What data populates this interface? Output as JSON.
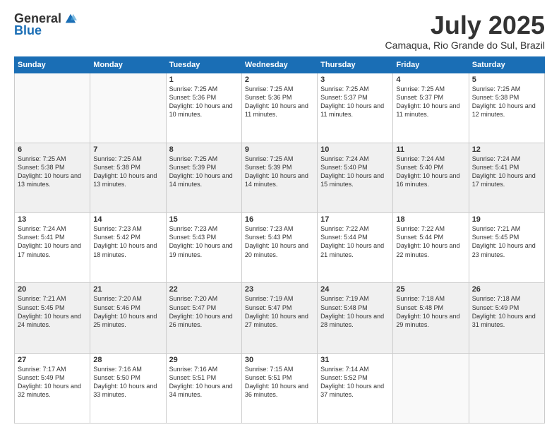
{
  "header": {
    "logo_general": "General",
    "logo_blue": "Blue",
    "month_title": "July 2025",
    "subtitle": "Camaqua, Rio Grande do Sul, Brazil"
  },
  "days_of_week": [
    "Sunday",
    "Monday",
    "Tuesday",
    "Wednesday",
    "Thursday",
    "Friday",
    "Saturday"
  ],
  "weeks": [
    [
      {
        "day": "",
        "info": ""
      },
      {
        "day": "",
        "info": ""
      },
      {
        "day": "1",
        "info": "Sunrise: 7:25 AM\nSunset: 5:36 PM\nDaylight: 10 hours and 10 minutes."
      },
      {
        "day": "2",
        "info": "Sunrise: 7:25 AM\nSunset: 5:36 PM\nDaylight: 10 hours and 11 minutes."
      },
      {
        "day": "3",
        "info": "Sunrise: 7:25 AM\nSunset: 5:37 PM\nDaylight: 10 hours and 11 minutes."
      },
      {
        "day": "4",
        "info": "Sunrise: 7:25 AM\nSunset: 5:37 PM\nDaylight: 10 hours and 11 minutes."
      },
      {
        "day": "5",
        "info": "Sunrise: 7:25 AM\nSunset: 5:38 PM\nDaylight: 10 hours and 12 minutes."
      }
    ],
    [
      {
        "day": "6",
        "info": "Sunrise: 7:25 AM\nSunset: 5:38 PM\nDaylight: 10 hours and 13 minutes."
      },
      {
        "day": "7",
        "info": "Sunrise: 7:25 AM\nSunset: 5:38 PM\nDaylight: 10 hours and 13 minutes."
      },
      {
        "day": "8",
        "info": "Sunrise: 7:25 AM\nSunset: 5:39 PM\nDaylight: 10 hours and 14 minutes."
      },
      {
        "day": "9",
        "info": "Sunrise: 7:25 AM\nSunset: 5:39 PM\nDaylight: 10 hours and 14 minutes."
      },
      {
        "day": "10",
        "info": "Sunrise: 7:24 AM\nSunset: 5:40 PM\nDaylight: 10 hours and 15 minutes."
      },
      {
        "day": "11",
        "info": "Sunrise: 7:24 AM\nSunset: 5:40 PM\nDaylight: 10 hours and 16 minutes."
      },
      {
        "day": "12",
        "info": "Sunrise: 7:24 AM\nSunset: 5:41 PM\nDaylight: 10 hours and 17 minutes."
      }
    ],
    [
      {
        "day": "13",
        "info": "Sunrise: 7:24 AM\nSunset: 5:41 PM\nDaylight: 10 hours and 17 minutes."
      },
      {
        "day": "14",
        "info": "Sunrise: 7:23 AM\nSunset: 5:42 PM\nDaylight: 10 hours and 18 minutes."
      },
      {
        "day": "15",
        "info": "Sunrise: 7:23 AM\nSunset: 5:43 PM\nDaylight: 10 hours and 19 minutes."
      },
      {
        "day": "16",
        "info": "Sunrise: 7:23 AM\nSunset: 5:43 PM\nDaylight: 10 hours and 20 minutes."
      },
      {
        "day": "17",
        "info": "Sunrise: 7:22 AM\nSunset: 5:44 PM\nDaylight: 10 hours and 21 minutes."
      },
      {
        "day": "18",
        "info": "Sunrise: 7:22 AM\nSunset: 5:44 PM\nDaylight: 10 hours and 22 minutes."
      },
      {
        "day": "19",
        "info": "Sunrise: 7:21 AM\nSunset: 5:45 PM\nDaylight: 10 hours and 23 minutes."
      }
    ],
    [
      {
        "day": "20",
        "info": "Sunrise: 7:21 AM\nSunset: 5:45 PM\nDaylight: 10 hours and 24 minutes."
      },
      {
        "day": "21",
        "info": "Sunrise: 7:20 AM\nSunset: 5:46 PM\nDaylight: 10 hours and 25 minutes."
      },
      {
        "day": "22",
        "info": "Sunrise: 7:20 AM\nSunset: 5:47 PM\nDaylight: 10 hours and 26 minutes."
      },
      {
        "day": "23",
        "info": "Sunrise: 7:19 AM\nSunset: 5:47 PM\nDaylight: 10 hours and 27 minutes."
      },
      {
        "day": "24",
        "info": "Sunrise: 7:19 AM\nSunset: 5:48 PM\nDaylight: 10 hours and 28 minutes."
      },
      {
        "day": "25",
        "info": "Sunrise: 7:18 AM\nSunset: 5:48 PM\nDaylight: 10 hours and 29 minutes."
      },
      {
        "day": "26",
        "info": "Sunrise: 7:18 AM\nSunset: 5:49 PM\nDaylight: 10 hours and 31 minutes."
      }
    ],
    [
      {
        "day": "27",
        "info": "Sunrise: 7:17 AM\nSunset: 5:49 PM\nDaylight: 10 hours and 32 minutes."
      },
      {
        "day": "28",
        "info": "Sunrise: 7:16 AM\nSunset: 5:50 PM\nDaylight: 10 hours and 33 minutes."
      },
      {
        "day": "29",
        "info": "Sunrise: 7:16 AM\nSunset: 5:51 PM\nDaylight: 10 hours and 34 minutes."
      },
      {
        "day": "30",
        "info": "Sunrise: 7:15 AM\nSunset: 5:51 PM\nDaylight: 10 hours and 36 minutes."
      },
      {
        "day": "31",
        "info": "Sunrise: 7:14 AM\nSunset: 5:52 PM\nDaylight: 10 hours and 37 minutes."
      },
      {
        "day": "",
        "info": ""
      },
      {
        "day": "",
        "info": ""
      }
    ]
  ]
}
